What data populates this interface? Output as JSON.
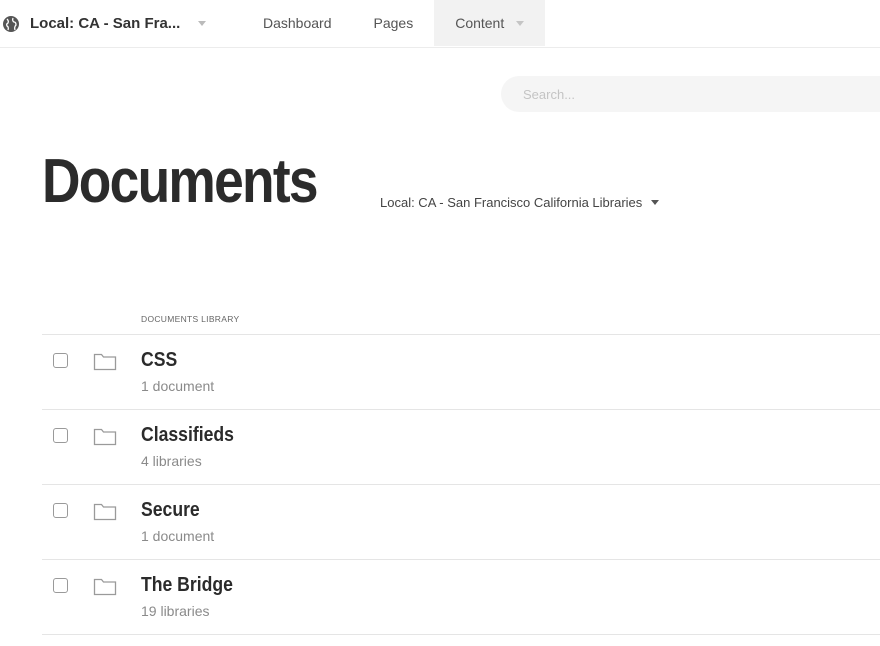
{
  "topbar": {
    "site_name": "Local: CA - San Fra...",
    "nav": [
      {
        "label": "Dashboard"
      },
      {
        "label": "Pages"
      },
      {
        "label": "Content"
      }
    ]
  },
  "search": {
    "placeholder": "Search..."
  },
  "page": {
    "title": "Documents",
    "site_breadcrumb": "Local: CA - San Francisco California Libraries"
  },
  "library": {
    "header": "DOCUMENTS LIBRARY",
    "items": [
      {
        "name": "CSS",
        "meta": "1 document"
      },
      {
        "name": "Classifieds",
        "meta": "4 libraries"
      },
      {
        "name": "Secure",
        "meta": "1 document"
      },
      {
        "name": "The Bridge",
        "meta": "19 libraries"
      }
    ]
  },
  "icons": {
    "globe": "globe-icon",
    "caret": "caret-down-icon",
    "folder": "folder-icon",
    "checkbox": "checkbox-icon"
  },
  "colors": {
    "title": "#2b2b2b",
    "meta": "#8a8a8a",
    "active_tab_bg": "#f2f2f2",
    "search_bg": "#f5f5f5"
  }
}
